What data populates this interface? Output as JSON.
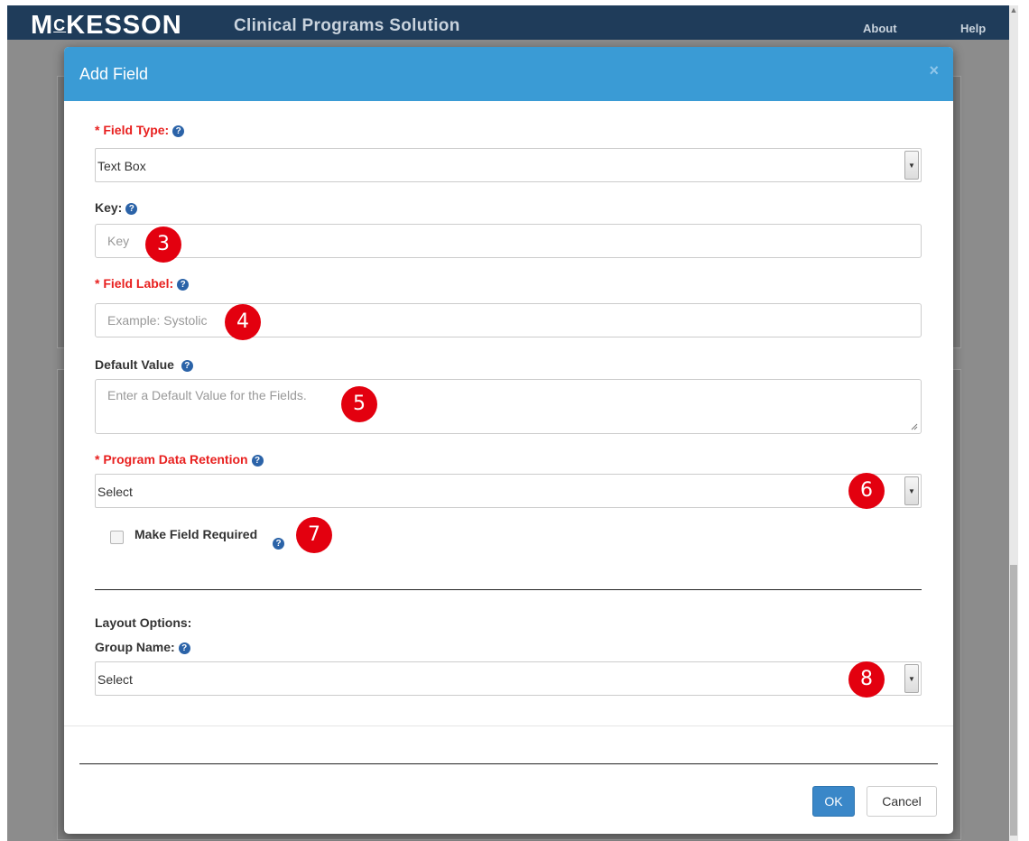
{
  "app": {
    "brand": "MCKESSON",
    "brand_prefix": "M",
    "brand_small": "C",
    "brand_rest": "KESSON",
    "title": "Clinical Programs Solution",
    "nav": {
      "about": "About",
      "help": "Help"
    }
  },
  "modal": {
    "title": "Add Field",
    "close_glyph": "×",
    "field_type": {
      "required_mark": "* ",
      "label": "Field Type:",
      "value": "Text Box"
    },
    "key": {
      "label": "Key:",
      "placeholder": "Key"
    },
    "field_label": {
      "required_mark": "* ",
      "label": "Field Label:",
      "placeholder": "Example: Systolic"
    },
    "default_value": {
      "label": "Default Value",
      "placeholder": "Enter a Default Value for the Fields."
    },
    "program_data_retention": {
      "required_mark": "* ",
      "label": "Program Data Retention",
      "value": "Select"
    },
    "make_required": {
      "label": "Make Field Required",
      "checked": false
    },
    "layout_options": {
      "heading": "Layout Options:"
    },
    "group_name": {
      "label": "Group Name:",
      "value": "Select"
    },
    "buttons": {
      "ok": "OK",
      "cancel": "Cancel"
    }
  },
  "annotations": [
    "3",
    "4",
    "5",
    "6",
    "7",
    "8"
  ],
  "icons": {
    "help": "question-circle-icon",
    "dropdown": "caret-down-icon",
    "resize": "resize-grip-icon"
  },
  "colors": {
    "header_bg": "#1f3c5a",
    "modal_header": "#3a9bd5",
    "required_label": "#e8201f",
    "help_icon": "#2b63a8",
    "annotation_badge": "#e3000f",
    "primary_button": "#3a87c8"
  }
}
